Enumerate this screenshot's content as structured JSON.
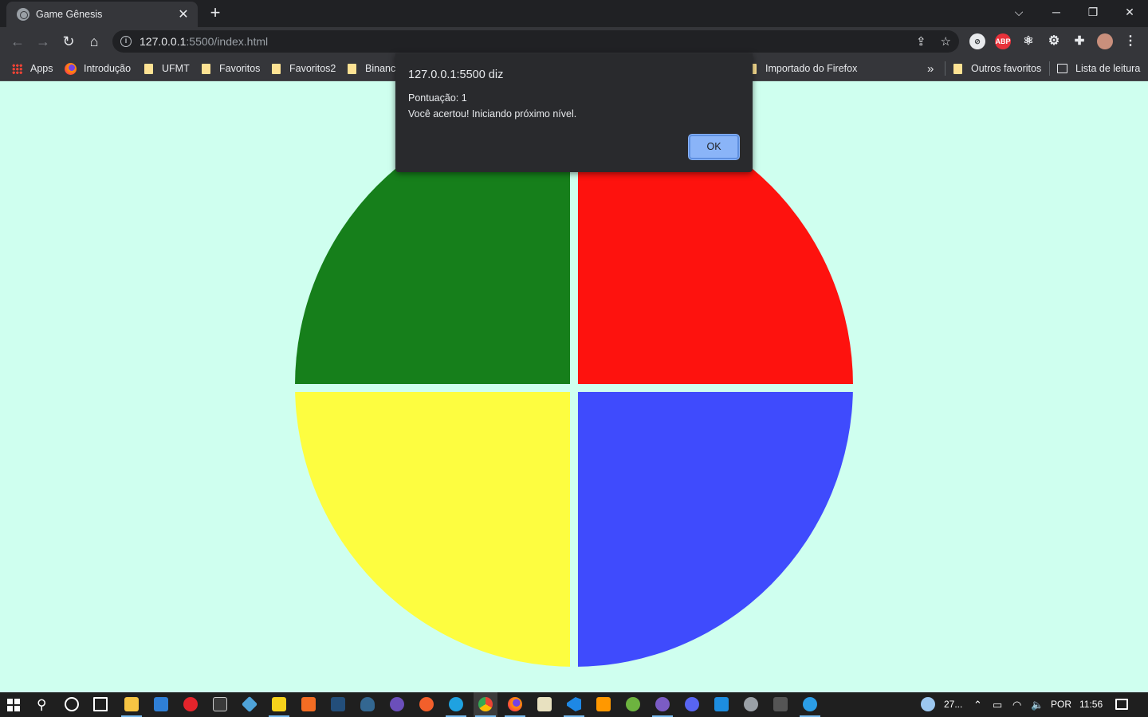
{
  "browser": {
    "tab_title": "Game Gênesis",
    "tab_close": "✕",
    "new_tab": "+",
    "url_host": "127.0.0.1",
    "url_rest": ":5500/index.html",
    "window_controls": {
      "dropdown": "⌵",
      "minimize": "─",
      "restore": "❐",
      "close": "✕"
    }
  },
  "bookmarks": {
    "apps": "Apps",
    "introducao": "Introdução",
    "ufmt": "UFMT",
    "favoritos": "Favoritos",
    "favoritos2": "Favoritos2",
    "binance": "Binance",
    "importado": "Importado do Firefox",
    "more": "»",
    "outros": "Outros favoritos",
    "lista": "Lista de leitura"
  },
  "extensions": {
    "abp": "ABP"
  },
  "dialog": {
    "title": "127.0.0.1:5500 diz",
    "line1": "Pontuação: 1",
    "line2": "Você acertou! Iniciando próximo nível.",
    "ok_label": "OK"
  },
  "game": {
    "colors": {
      "green": "#167f1b",
      "red": "#fe120e",
      "yellow": "#fdfd40",
      "blue": "#3f4bfd",
      "background": "#cfffef"
    }
  },
  "taskbar": {
    "weather": "27...",
    "language": "POR",
    "time": "11:56"
  }
}
